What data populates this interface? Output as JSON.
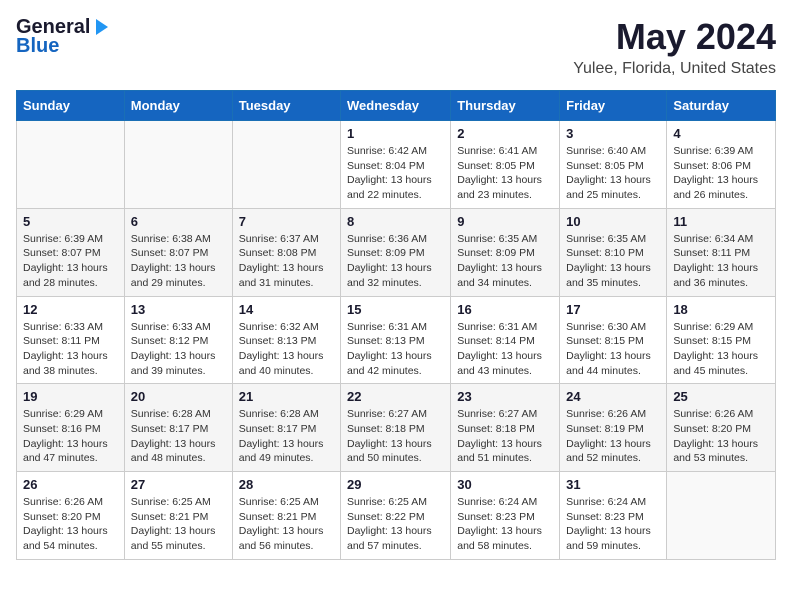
{
  "header": {
    "logo_general": "General",
    "logo_blue": "Blue",
    "title": "May 2024",
    "subtitle": "Yulee, Florida, United States"
  },
  "weekdays": [
    "Sunday",
    "Monday",
    "Tuesday",
    "Wednesday",
    "Thursday",
    "Friday",
    "Saturday"
  ],
  "weeks": [
    [
      {
        "day": "",
        "info": ""
      },
      {
        "day": "",
        "info": ""
      },
      {
        "day": "",
        "info": ""
      },
      {
        "day": "1",
        "info": "Sunrise: 6:42 AM\nSunset: 8:04 PM\nDaylight: 13 hours\nand 22 minutes."
      },
      {
        "day": "2",
        "info": "Sunrise: 6:41 AM\nSunset: 8:05 PM\nDaylight: 13 hours\nand 23 minutes."
      },
      {
        "day": "3",
        "info": "Sunrise: 6:40 AM\nSunset: 8:05 PM\nDaylight: 13 hours\nand 25 minutes."
      },
      {
        "day": "4",
        "info": "Sunrise: 6:39 AM\nSunset: 8:06 PM\nDaylight: 13 hours\nand 26 minutes."
      }
    ],
    [
      {
        "day": "5",
        "info": "Sunrise: 6:39 AM\nSunset: 8:07 PM\nDaylight: 13 hours\nand 28 minutes."
      },
      {
        "day": "6",
        "info": "Sunrise: 6:38 AM\nSunset: 8:07 PM\nDaylight: 13 hours\nand 29 minutes."
      },
      {
        "day": "7",
        "info": "Sunrise: 6:37 AM\nSunset: 8:08 PM\nDaylight: 13 hours\nand 31 minutes."
      },
      {
        "day": "8",
        "info": "Sunrise: 6:36 AM\nSunset: 8:09 PM\nDaylight: 13 hours\nand 32 minutes."
      },
      {
        "day": "9",
        "info": "Sunrise: 6:35 AM\nSunset: 8:09 PM\nDaylight: 13 hours\nand 34 minutes."
      },
      {
        "day": "10",
        "info": "Sunrise: 6:35 AM\nSunset: 8:10 PM\nDaylight: 13 hours\nand 35 minutes."
      },
      {
        "day": "11",
        "info": "Sunrise: 6:34 AM\nSunset: 8:11 PM\nDaylight: 13 hours\nand 36 minutes."
      }
    ],
    [
      {
        "day": "12",
        "info": "Sunrise: 6:33 AM\nSunset: 8:11 PM\nDaylight: 13 hours\nand 38 minutes."
      },
      {
        "day": "13",
        "info": "Sunrise: 6:33 AM\nSunset: 8:12 PM\nDaylight: 13 hours\nand 39 minutes."
      },
      {
        "day": "14",
        "info": "Sunrise: 6:32 AM\nSunset: 8:13 PM\nDaylight: 13 hours\nand 40 minutes."
      },
      {
        "day": "15",
        "info": "Sunrise: 6:31 AM\nSunset: 8:13 PM\nDaylight: 13 hours\nand 42 minutes."
      },
      {
        "day": "16",
        "info": "Sunrise: 6:31 AM\nSunset: 8:14 PM\nDaylight: 13 hours\nand 43 minutes."
      },
      {
        "day": "17",
        "info": "Sunrise: 6:30 AM\nSunset: 8:15 PM\nDaylight: 13 hours\nand 44 minutes."
      },
      {
        "day": "18",
        "info": "Sunrise: 6:29 AM\nSunset: 8:15 PM\nDaylight: 13 hours\nand 45 minutes."
      }
    ],
    [
      {
        "day": "19",
        "info": "Sunrise: 6:29 AM\nSunset: 8:16 PM\nDaylight: 13 hours\nand 47 minutes."
      },
      {
        "day": "20",
        "info": "Sunrise: 6:28 AM\nSunset: 8:17 PM\nDaylight: 13 hours\nand 48 minutes."
      },
      {
        "day": "21",
        "info": "Sunrise: 6:28 AM\nSunset: 8:17 PM\nDaylight: 13 hours\nand 49 minutes."
      },
      {
        "day": "22",
        "info": "Sunrise: 6:27 AM\nSunset: 8:18 PM\nDaylight: 13 hours\nand 50 minutes."
      },
      {
        "day": "23",
        "info": "Sunrise: 6:27 AM\nSunset: 8:18 PM\nDaylight: 13 hours\nand 51 minutes."
      },
      {
        "day": "24",
        "info": "Sunrise: 6:26 AM\nSunset: 8:19 PM\nDaylight: 13 hours\nand 52 minutes."
      },
      {
        "day": "25",
        "info": "Sunrise: 6:26 AM\nSunset: 8:20 PM\nDaylight: 13 hours\nand 53 minutes."
      }
    ],
    [
      {
        "day": "26",
        "info": "Sunrise: 6:26 AM\nSunset: 8:20 PM\nDaylight: 13 hours\nand 54 minutes."
      },
      {
        "day": "27",
        "info": "Sunrise: 6:25 AM\nSunset: 8:21 PM\nDaylight: 13 hours\nand 55 minutes."
      },
      {
        "day": "28",
        "info": "Sunrise: 6:25 AM\nSunset: 8:21 PM\nDaylight: 13 hours\nand 56 minutes."
      },
      {
        "day": "29",
        "info": "Sunrise: 6:25 AM\nSunset: 8:22 PM\nDaylight: 13 hours\nand 57 minutes."
      },
      {
        "day": "30",
        "info": "Sunrise: 6:24 AM\nSunset: 8:23 PM\nDaylight: 13 hours\nand 58 minutes."
      },
      {
        "day": "31",
        "info": "Sunrise: 6:24 AM\nSunset: 8:23 PM\nDaylight: 13 hours\nand 59 minutes."
      },
      {
        "day": "",
        "info": ""
      }
    ]
  ]
}
